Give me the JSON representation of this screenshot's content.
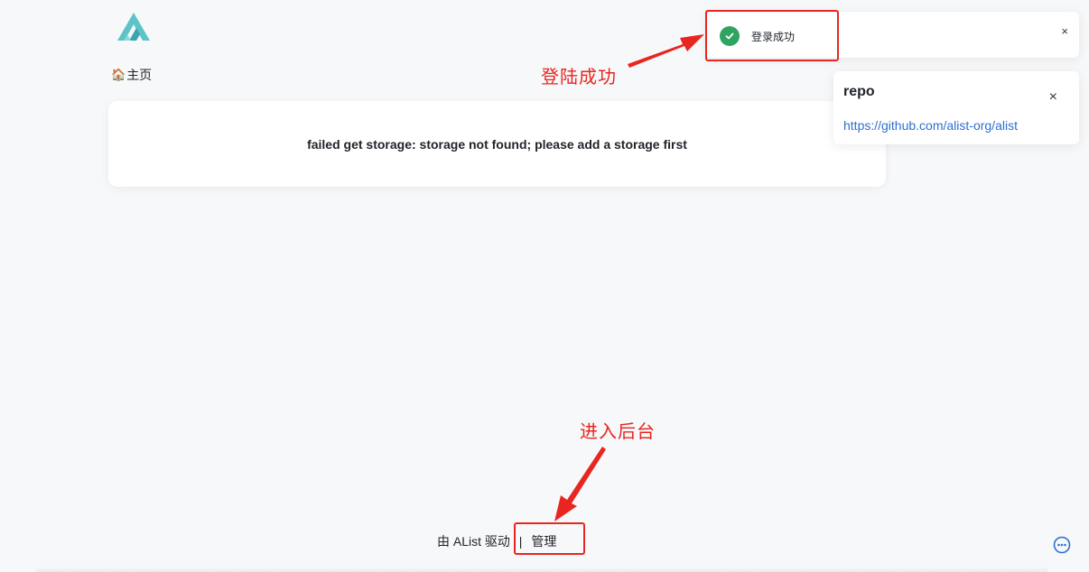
{
  "breadcrumb": {
    "home_emoji": "🏠",
    "home_label": "主页"
  },
  "main": {
    "error_message": "failed get storage: storage not found; please add a storage first"
  },
  "toast": {
    "message": "登录成功",
    "close_symbol": "×",
    "status_color": "#2fa461"
  },
  "notification": {
    "title": "repo",
    "link_text": "https://github.com/alist-org/alist",
    "close_symbol": "×"
  },
  "annotations": {
    "login_success": "登陆成功",
    "enter_admin": "进入后台",
    "color": "#e8261f"
  },
  "footer": {
    "powered_by": "由 AList 驱动",
    "separator": "|",
    "manage_label": "管理"
  },
  "icons": {
    "logo": "alist-logo-icon",
    "more": "more-horizontal-circle-icon",
    "success": "check-circle-icon"
  }
}
